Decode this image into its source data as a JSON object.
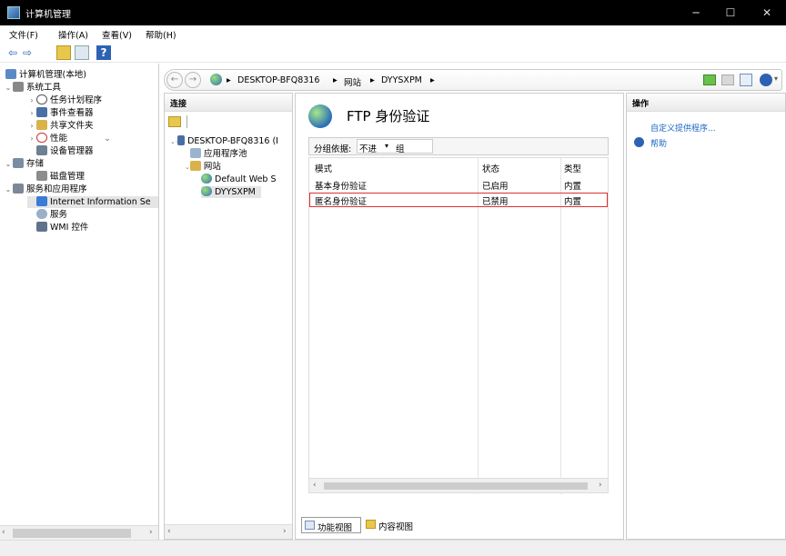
{
  "window": {
    "title": "计算机管理",
    "controls": {
      "minimize": "─",
      "maximize": "☐",
      "close": "✕"
    }
  },
  "menu": [
    "文件(F)",
    "操作(A)",
    "查看(V)",
    "帮助(H)"
  ],
  "toolbar": {
    "back": "⇦",
    "forward": "⇨",
    "help": "?"
  },
  "tree": {
    "root": "计算机管理(本地)",
    "system_tools": "系统工具",
    "task_scheduler": "任务计划程序",
    "event_viewer": "事件查看器",
    "shared_folders": "共享文件夹",
    "performance": "性能",
    "device_manager": "设备管理器",
    "storage": "存储",
    "disk_management": "磁盘管理",
    "services_apps": "服务和应用程序",
    "iis": "Internet Information Se",
    "services": "服务",
    "wmi": "WMI 控件"
  },
  "address": {
    "crumbs": [
      "DESKTOP-BFQ8316",
      "网站",
      "DYYSXPM"
    ]
  },
  "connections": {
    "header": "连接",
    "host": "DESKTOP-BFQ8316 (I",
    "app_pools": "应用程序池",
    "sites": "网站",
    "default_site": "Default Web S",
    "selected_site": "DYYSXPM"
  },
  "feature": {
    "title": "FTP 身份验证",
    "group_label": "分组依据:",
    "group_value": "不进",
    "group_suffix": "组",
    "columns": [
      "模式",
      "状态",
      "类型"
    ],
    "rows": [
      {
        "mode": "基本身份验证",
        "status": "已启用",
        "type": "内置"
      },
      {
        "mode": "匿名身份验证",
        "status": "已禁用",
        "type": "内置"
      }
    ]
  },
  "views": {
    "features": "功能视图",
    "content": "内容视图"
  },
  "actions": {
    "header": "操作",
    "custom_provider": "自定义提供程序...",
    "help": "帮助"
  }
}
